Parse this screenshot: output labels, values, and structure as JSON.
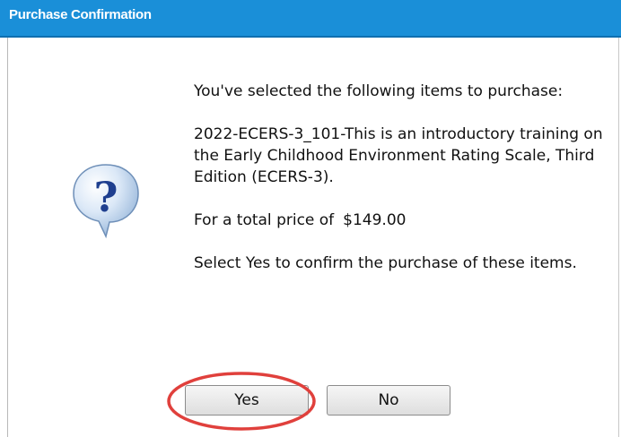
{
  "dialog": {
    "title": "Purchase Confirmation",
    "icon": "question-speech-bubble-icon",
    "intro": "You've selected the following items to purchase:",
    "item_description": "2022-ECERS-3_101-This is an introductory training on the Early Childhood Environment Rating Scale, Third Edition (ECERS-3).",
    "price_label": "For a total price of",
    "price_value": "$149.00",
    "confirm_text": "Select Yes to confirm the purchase of these items."
  },
  "buttons": {
    "yes_label": "Yes",
    "no_label": "No"
  },
  "colors": {
    "titlebar": "#1a8fd8",
    "highlight_ring": "#e0403c"
  }
}
